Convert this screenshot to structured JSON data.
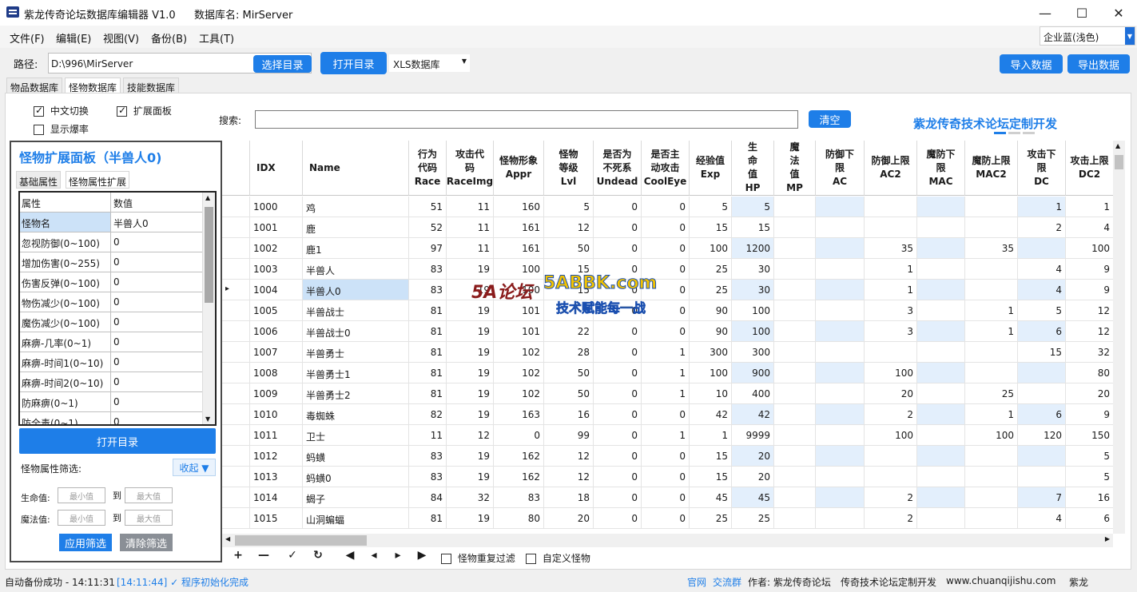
{
  "window": {
    "title": "紫龙传奇论坛数据库编辑器 V1.0",
    "db_label": "数据库名: MirServer",
    "minimize": "—",
    "maximize": "☐",
    "close": "✕"
  },
  "menu": [
    "文件(F)",
    "编辑(E)",
    "视图(V)",
    "备份(B)",
    "工具(T)"
  ],
  "theme": "企业蓝(浅色)",
  "toolbar": {
    "path_label": "路径:",
    "path_value": "D:\\996\\MirServer",
    "choose_dir": "选择目录",
    "open_dir": "打开目录",
    "db_type": "XLS数据库",
    "import": "导入数据",
    "export": "导出数据"
  },
  "tabs": [
    "物品数据库",
    "怪物数据库",
    "技能数据库"
  ],
  "options": {
    "cn_switch": "中文切换",
    "expand_panel": "扩展面板",
    "show_drop": "显示爆率"
  },
  "search": {
    "label": "搜索:",
    "clear": "清空"
  },
  "brand": "紫龙传奇技术论坛定制开发",
  "panel": {
    "title": "怪物扩展面板（半兽人0)",
    "tabs": [
      "基础属性",
      "怪物属性扩展"
    ],
    "col_key": "属性",
    "col_val": "数值",
    "rows": [
      {
        "k": "怪物名",
        "v": "半兽人0"
      },
      {
        "k": "忽视防御(0~100)",
        "v": "0"
      },
      {
        "k": "增加伤害(0~255)",
        "v": "0"
      },
      {
        "k": "伤害反弹(0~100)",
        "v": "0"
      },
      {
        "k": "物伤减少(0~100)",
        "v": "0"
      },
      {
        "k": "魔伤减少(0~100)",
        "v": "0"
      },
      {
        "k": "麻痹-几率(0~1)",
        "v": "0"
      },
      {
        "k": "麻痹-时间1(0~10)",
        "v": "0"
      },
      {
        "k": "麻痹-时间2(0~10)",
        "v": "0"
      },
      {
        "k": "防麻痹(0~1)",
        "v": "0"
      },
      {
        "k": "防全毒(0~1)",
        "v": "0"
      }
    ],
    "open_dir": "打开目录",
    "filter_label": "怪物属性筛选:",
    "collapse": "收起 ▼",
    "hp_label": "生命值:",
    "mp_label": "魔法值:",
    "min_ph": "最小值",
    "max_ph": "最大值",
    "to": "到",
    "apply": "应用筛选",
    "clear": "清除筛选"
  },
  "grid": {
    "headers": [
      {
        "t": ""
      },
      {
        "t": "IDX"
      },
      {
        "t": "Name"
      },
      {
        "t": "行为\n代码\nRace"
      },
      {
        "t": "攻击代\n码\nRaceImg"
      },
      {
        "t": "怪物形象\nAppr"
      },
      {
        "t": "怪物\n等级\nLvl"
      },
      {
        "t": "是否为\n不死系\nUndead"
      },
      {
        "t": "是否主\n动攻击\nCoolEye"
      },
      {
        "t": "经验值\nExp"
      },
      {
        "t": "生\n命\n值\nHP"
      },
      {
        "t": "魔\n法\n值\nMP"
      },
      {
        "t": "防御下\n限\nAC"
      },
      {
        "t": "防御上限\nAC2"
      },
      {
        "t": "魔防下\n限\nMAC"
      },
      {
        "t": "魔防上限\nMAC2"
      },
      {
        "t": "攻击下\n限\nDC"
      },
      {
        "t": "攻击上限\nDC2"
      }
    ],
    "rows": [
      [
        "1000",
        "鸡",
        "51",
        "11",
        "160",
        "5",
        "0",
        "0",
        "5",
        "5",
        "",
        "",
        "",
        "",
        "",
        "1",
        "1"
      ],
      [
        "1001",
        "鹿",
        "52",
        "11",
        "161",
        "12",
        "0",
        "0",
        "15",
        "15",
        "",
        "",
        "",
        "",
        "",
        "2",
        "4"
      ],
      [
        "1002",
        "鹿1",
        "97",
        "11",
        "161",
        "50",
        "0",
        "0",
        "100",
        "1200",
        "",
        "",
        "35",
        "",
        "35",
        "",
        "100"
      ],
      [
        "1003",
        "半兽人",
        "83",
        "19",
        "100",
        "15",
        "0",
        "0",
        "25",
        "30",
        "",
        "",
        "1",
        "",
        "",
        "4",
        "9"
      ],
      [
        "1004",
        "半兽人0",
        "83",
        "19",
        "100",
        "15",
        "0",
        "0",
        "25",
        "30",
        "",
        "",
        "1",
        "",
        "",
        "4",
        "9"
      ],
      [
        "1005",
        "半兽战士",
        "81",
        "19",
        "101",
        "",
        "0",
        "0",
        "90",
        "100",
        "",
        "",
        "3",
        "",
        "1",
        "5",
        "12"
      ],
      [
        "1006",
        "半兽战士0",
        "81",
        "19",
        "101",
        "22",
        "0",
        "0",
        "90",
        "100",
        "",
        "",
        "3",
        "",
        "1",
        "6",
        "12"
      ],
      [
        "1007",
        "半兽勇士",
        "81",
        "19",
        "102",
        "28",
        "0",
        "1",
        "300",
        "300",
        "",
        "",
        "",
        "",
        "",
        "15",
        "32"
      ],
      [
        "1008",
        "半兽勇士1",
        "81",
        "19",
        "102",
        "50",
        "0",
        "1",
        "100",
        "900",
        "",
        "",
        "100",
        "",
        "",
        "",
        "80"
      ],
      [
        "1009",
        "半兽勇士2",
        "81",
        "19",
        "102",
        "50",
        "0",
        "1",
        "10",
        "400",
        "",
        "",
        "20",
        "",
        "25",
        "",
        "20"
      ],
      [
        "1010",
        "毒蜘蛛",
        "82",
        "19",
        "163",
        "16",
        "0",
        "0",
        "42",
        "42",
        "",
        "",
        "2",
        "",
        "1",
        "6",
        "9"
      ],
      [
        "1011",
        "卫士",
        "11",
        "12",
        "0",
        "99",
        "0",
        "1",
        "1",
        "9999",
        "",
        "",
        "100",
        "",
        "100",
        "120",
        "150"
      ],
      [
        "1012",
        "蚂蟥",
        "83",
        "19",
        "162",
        "12",
        "0",
        "0",
        "15",
        "20",
        "",
        "",
        "",
        "",
        "",
        "",
        "5"
      ],
      [
        "1013",
        "蚂蟥0",
        "83",
        "19",
        "162",
        "12",
        "0",
        "0",
        "15",
        "20",
        "",
        "",
        "",
        "",
        "",
        "",
        "5"
      ],
      [
        "1014",
        "蝎子",
        "84",
        "32",
        "83",
        "18",
        "0",
        "0",
        "45",
        "45",
        "",
        "",
        "2",
        "",
        "",
        "7",
        "16"
      ],
      [
        "1015",
        "山洞蝙蝠",
        "81",
        "19",
        "80",
        "20",
        "0",
        "0",
        "25",
        "25",
        "",
        "",
        "2",
        "",
        "",
        "4",
        "6"
      ]
    ]
  },
  "nav": [
    "+",
    "—",
    "✓",
    "↻",
    "◀",
    "◂",
    "▸",
    "▶"
  ],
  "bottom_opts": {
    "dup_filter": "怪物重复过滤",
    "custom": "自定义怪物"
  },
  "watermark": {
    "logo": "5A论坛",
    "site": "5ABBK.com",
    "slogan": "技术赋能每一战"
  },
  "status": {
    "backup": "自动备份成功 - 14:11:31",
    "log": "[14:11:44] ✓ 程序初始化完成",
    "site": "官网",
    "group": "交流群",
    "author": "作者: 紫龙传奇论坛",
    "dev": "传奇技术论坛定制开发",
    "url": "www.chuanqijishu.com",
    "name": "紫龙"
  }
}
